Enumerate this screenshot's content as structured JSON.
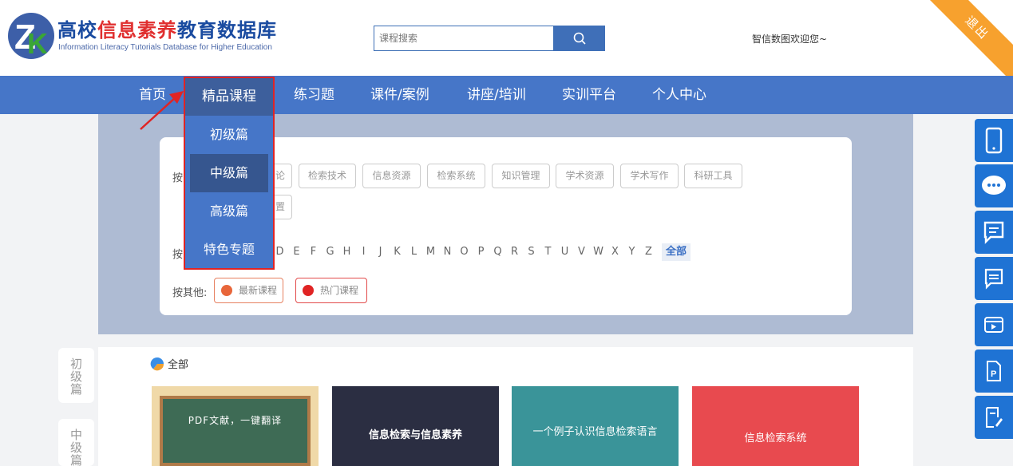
{
  "brand": {
    "title_part1": "高校",
    "title_part2": "信息素养",
    "title_part3": "教育数据库",
    "subtitle": "Information Literacy Tutorials Database for Higher Education"
  },
  "search": {
    "placeholder": "课程搜索"
  },
  "header": {
    "welcome": "智信数图欢迎您~",
    "logout": "退出"
  },
  "nav": {
    "items": [
      "首页",
      "精品课程",
      "练习题",
      "课件/案例",
      "讲座/培训",
      "实训平台",
      "个人中心"
    ]
  },
  "dropdown": {
    "items": [
      "初级篇",
      "中级篇",
      "高级篇",
      "特色专题"
    ],
    "selected": "中级篇"
  },
  "filter": {
    "by_category_label": "按",
    "category_tags": [
      "论",
      "检索技术",
      "信息资源",
      "检索系统",
      "知识管理",
      "学术资源",
      "学术写作",
      "科研工具",
      "置"
    ],
    "by_letter_label": "按",
    "letters": [
      "D",
      "E",
      "F",
      "G",
      "H",
      "I",
      "J",
      "K",
      "L",
      "M",
      "N",
      "O",
      "P",
      "Q",
      "R",
      "S",
      "T",
      "U",
      "V",
      "W",
      "X",
      "Y",
      "Z"
    ],
    "all_letters": "全部",
    "other_label": "按其他:",
    "other_tags": [
      "最新课程",
      "热门课程"
    ]
  },
  "side_tabs": [
    "初级篇",
    "中级篇"
  ],
  "content": {
    "section_label": "全部",
    "cards": [
      {
        "title": "PDF文献，一键翻译",
        "bg": "#f0d9a8"
      },
      {
        "title": "信息检索与信息素养",
        "bg": "#2b2e42"
      },
      {
        "title": "一个例子认识信息检索语言",
        "bg": "#3a9499"
      },
      {
        "title": "信息检索系统",
        "bg": "#e84a4f"
      }
    ]
  },
  "right_toolbar": [
    "phone-icon",
    "wechat-icon",
    "feedback-icon",
    "message-icon",
    "video-icon",
    "ppt-icon",
    "edit-icon"
  ],
  "colors": {
    "nav": "#4676c8",
    "nav_active": "#3d5f9c",
    "toolbar": "#1f73d4",
    "ribbon": "#f7a12e"
  }
}
